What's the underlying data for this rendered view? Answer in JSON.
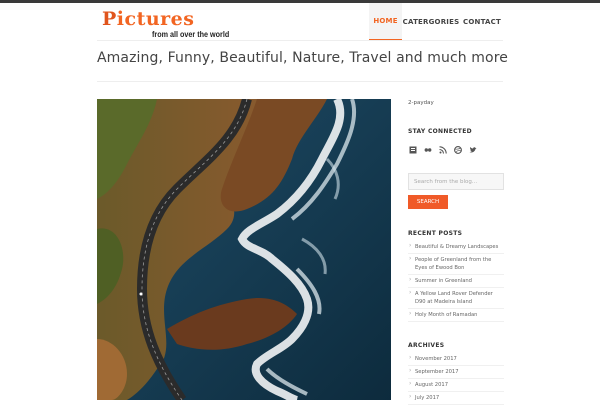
{
  "header": {
    "logo_main": "Pictures",
    "logo_sub": "from all over the world"
  },
  "nav": {
    "items": [
      {
        "label": "HOME",
        "active": true
      },
      {
        "label": "CATERGORIES",
        "active": false
      },
      {
        "label": "CONTACT",
        "active": false
      }
    ]
  },
  "main": {
    "tagline": "Amazing, Funny, Beautiful, Nature, Travel and much more",
    "photo_subject": "aerial coastal road with ocean waves"
  },
  "sidebar": {
    "top_link": "2-payday",
    "stay_connected": {
      "heading": "STAY CONNECTED",
      "icons": [
        "blog-icon",
        "flickr-icon",
        "rss-icon",
        "dribbble-icon",
        "twitter-icon"
      ]
    },
    "search": {
      "placeholder": "Search from the blog...",
      "button_label": "SEARCH"
    },
    "recent_posts": {
      "heading": "RECENT POSTS",
      "items": [
        "Beautiful & Dreamy Landscapes",
        "People of Greenland from the Eyes of Ewood Bon",
        "Summer in Greenland",
        "A Yellow Land Rover Defender D90 at Madeira Island",
        "Holy Month of Ramadan"
      ]
    },
    "archives": {
      "heading": "ARCHIVES",
      "items": [
        "November 2017",
        "September 2017",
        "August 2017",
        "July 2017"
      ]
    }
  },
  "colors": {
    "accent": "#f26522",
    "top_bar": "#3a3a3a",
    "text": "#444444"
  }
}
